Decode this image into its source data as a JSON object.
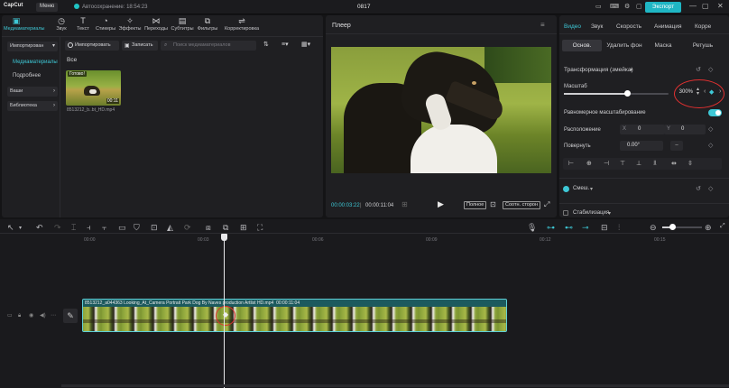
{
  "app": {
    "logo": "CapCut",
    "menu_label": "Меню",
    "autosave": "Автосохранение: 18:54:23",
    "project_title": "0817",
    "export_label": "Экспорт"
  },
  "toolbar_tabs": [
    {
      "label": "Медиаматериалы",
      "icon": "media-icon"
    },
    {
      "label": "Звук",
      "icon": "audio-icon"
    },
    {
      "label": "Текст",
      "icon": "text-icon"
    },
    {
      "label": "Стикеры",
      "icon": "sticker-icon"
    },
    {
      "label": "Эффекты",
      "icon": "effects-icon"
    },
    {
      "label": "Переходы",
      "icon": "transitions-icon"
    },
    {
      "label": "Субтитры",
      "icon": "captions-icon"
    },
    {
      "label": "Фильтры",
      "icon": "filters-icon"
    },
    {
      "label": "Корректировка",
      "icon": "adjust-icon"
    }
  ],
  "media_sidebar": {
    "import_btn": "Импортирован",
    "items": [
      "Медиаматериалы",
      "Подробнее"
    ],
    "yours_btn": "Ваши",
    "library_btn": "Библиотека"
  },
  "media_toolbar": {
    "import": "Импортировать",
    "record": "Записать",
    "search_placeholder": "Поиск медиаматериалов"
  },
  "media_content": {
    "section": "Все",
    "clip_status": "Готово!",
    "clip_duration": "00:11",
    "clip_name": "8513212_b..bt_HD.mp4"
  },
  "player": {
    "title": "Плеер",
    "current_time": "00:00:03:22",
    "total_time": "00:00:11:04",
    "quality_btn": "Полное",
    "ratio_btn": "Соотн. сторон"
  },
  "properties": {
    "tabs": [
      "Видео",
      "Звук",
      "Скорость",
      "Анимация",
      "Корре"
    ],
    "subtabs": [
      "Основ.",
      "Удалить фон",
      "Маска",
      "Ретушь"
    ],
    "transform_label": "Трансформация (змейка)",
    "scale_label": "Масштаб",
    "scale_value": "300%",
    "scale_fraction": 0.6,
    "uniform_label": "Равномерное масштабирование",
    "position_label": "Расположение",
    "pos_x_label": "X",
    "pos_x": "0",
    "pos_y_label": "Y",
    "pos_y": "0",
    "rotate_label": "Повернуть",
    "rotate_value": "0.00°",
    "blend_label": "Смеш.",
    "stabilize_label": "Стабилизация",
    "accent": "#3ec8d6",
    "highlight_color": "#e03030"
  },
  "timeline": {
    "ruler": [
      "00:00",
      "00:03",
      "00:06",
      "00:09",
      "00:12",
      "00:15"
    ],
    "clip_label": "8513212_a044363 Looking_At_Camera Portrait Park Dog By Naves production Artlist HD.mp4",
    "clip_duration": "00:00:11:04"
  }
}
